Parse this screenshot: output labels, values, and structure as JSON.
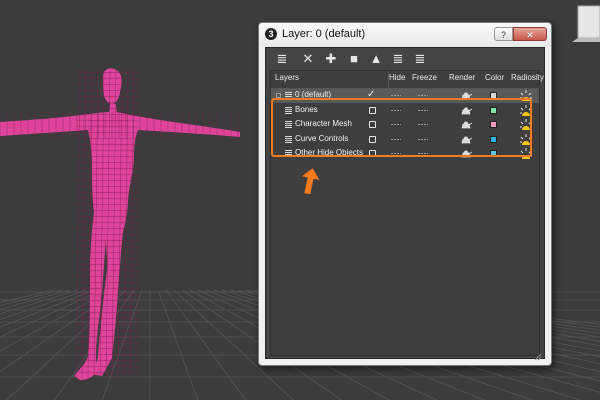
{
  "window": {
    "title": "Layer: 0 (default)",
    "help_label": "?",
    "close_label": "✕"
  },
  "toolbar": [
    {
      "name": "create-layer-icon",
      "glyph": "≣"
    },
    {
      "name": "delete-layer-icon",
      "glyph": "✕"
    },
    {
      "name": "add-to-layer-icon",
      "glyph": "✚"
    },
    {
      "name": "select-objects-icon",
      "glyph": "■"
    },
    {
      "name": "highlight-layer-icon",
      "glyph": "▲"
    },
    {
      "name": "hide-all-icon",
      "glyph": "≣"
    },
    {
      "name": "freeze-all-icon",
      "glyph": "≣"
    }
  ],
  "columns": {
    "layers": "Layers",
    "hide": "Hide",
    "freeze": "Freeze",
    "render": "Render",
    "color": "Color",
    "radiosity": "Radiosity"
  },
  "layers": [
    {
      "name": "0 (default)",
      "current": true,
      "color": "#d9d9d9"
    },
    {
      "name": "Bones",
      "current": false,
      "color": "#7fe6a4"
    },
    {
      "name": "Character Mesh",
      "current": false,
      "color": "#f29bc0"
    },
    {
      "name": "Curve Controls",
      "current": false,
      "color": "#2bb3e6"
    },
    {
      "name": "Other Hide Objects",
      "current": false,
      "color": "#5ac6e8"
    }
  ],
  "colors": {
    "highlight": "#f47a1d",
    "mesh": "#e0449a",
    "grid": "#5a5a5a"
  }
}
